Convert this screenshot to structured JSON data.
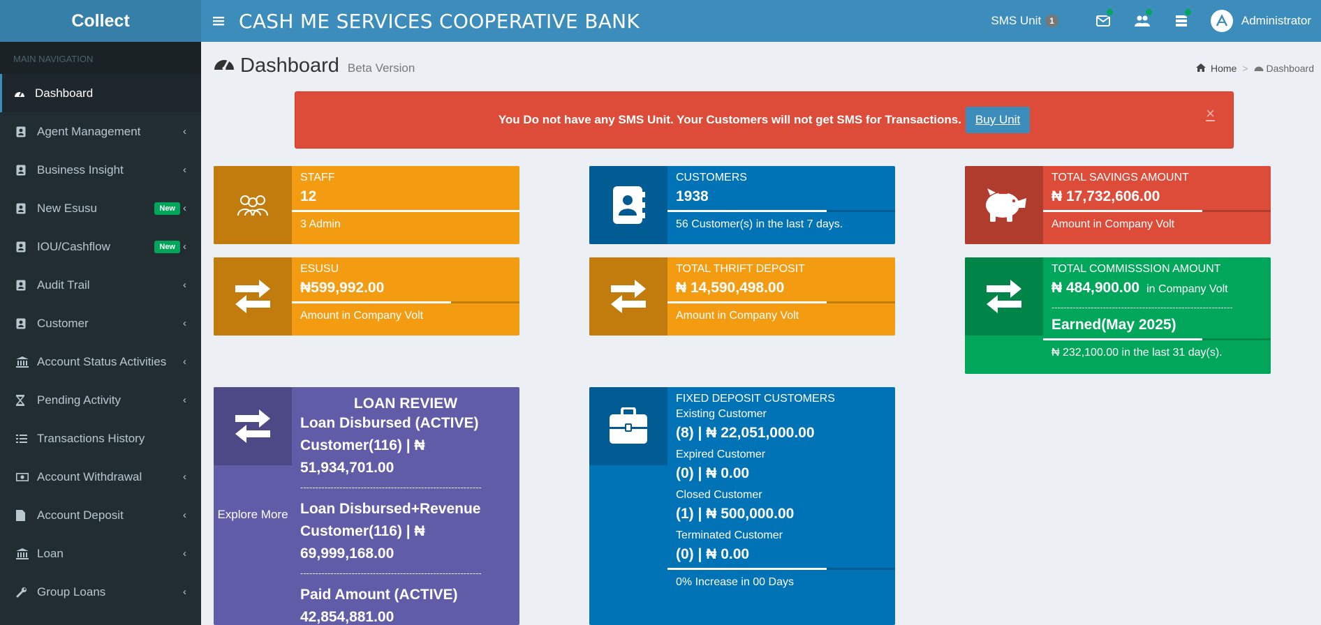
{
  "app": {
    "logo": "Collect",
    "bank_name": "CASH ME SERVICES COOPERATIVE BANK"
  },
  "topbar": {
    "sms_label": "SMS Unit",
    "sms_count": "1",
    "user_name": "Administrator",
    "icons": [
      "envelope-icon",
      "users-icon",
      "server-icon"
    ]
  },
  "sidebar": {
    "header": "MAIN NAVIGATION",
    "items": [
      {
        "label": "Dashboard",
        "icon": "dashboard-icon"
      },
      {
        "label": "Agent Management",
        "icon": "contact-icon"
      },
      {
        "label": "Business Insight",
        "icon": "contact-icon"
      },
      {
        "label": "New Esusu",
        "icon": "contact-icon",
        "badge": "New"
      },
      {
        "label": "IOU/Cashflow",
        "icon": "contact-icon",
        "badge": "New"
      },
      {
        "label": "Audit Trail",
        "icon": "contact-icon"
      },
      {
        "label": "Customer",
        "icon": "contact-icon"
      },
      {
        "label": "Account Status Activities",
        "icon": "bank-icon"
      },
      {
        "label": "Pending Activity",
        "icon": "hourglass-icon"
      },
      {
        "label": "Transactions History",
        "icon": "list-icon"
      },
      {
        "label": "Account Withdrawal",
        "icon": "money-icon"
      },
      {
        "label": "Account Deposit",
        "icon": "file-icon"
      },
      {
        "label": "Loan",
        "icon": "bank-icon"
      },
      {
        "label": "Group Loans",
        "icon": "wrench-icon"
      }
    ]
  },
  "page": {
    "title": "Dashboard",
    "subtitle": "Beta Version",
    "breadcrumb": {
      "home": "Home",
      "current": "Dashboard"
    }
  },
  "alert": {
    "text": "You Do not have any SMS Unit. Your Customers will not get SMS for Transactions.",
    "button": "Buy Unit",
    "close": "×"
  },
  "boxes": {
    "staff": {
      "label": "STAFF",
      "value": "12",
      "desc": "3 Admin",
      "progress": 1.0
    },
    "customers": {
      "label": "CUSTOMERS",
      "value": "1938",
      "desc": "56 Customer(s) in the last 7 days.",
      "progress": 0.7
    },
    "savings": {
      "label": "TOTAL SAVINGS AMOUNT",
      "value": "₦ 17,732,606.00",
      "desc": "Amount in Company Volt",
      "progress": 0.7
    },
    "esusu": {
      "label": "ESUSU",
      "value": "₦599,992.00",
      "desc": "Amount in Company Volt",
      "progress": 0.7
    },
    "thrift": {
      "label": "TOTAL THRIFT DEPOSIT",
      "value": "₦ 14,590,498.00",
      "desc": "Amount in Company Volt",
      "progress": 0.7
    },
    "commission": {
      "label": "TOTAL COMMISSSION AMOUNT",
      "value": "₦ 484,900.00",
      "value_suffix": "in Company Volt",
      "dashes": "------------------------------------------------------------",
      "earned": "Earned(May 2025)",
      "desc": "₦ 232,100.00 in the last 31 day(s).",
      "progress": 0.7
    },
    "loan": {
      "title": "LOAN REVIEW",
      "explore": "Explore More",
      "line1": "Loan Disbursed (ACTIVE) Customer(116) | ₦ 51,934,701.00",
      "line2": "Loan Disbursed+Revenue Customer(116) | ₦ 69,999,168.00",
      "line3": "Paid Amount (ACTIVE) 42,854,881.00",
      "dashes": "------------------------------------------------------------"
    },
    "fixed": {
      "label": "FIXED DEPOSIT CUSTOMERS",
      "existing_label": "Existing Customer",
      "existing_value": "(8) | ₦ 22,051,000.00",
      "expired_label": "Expired Customer",
      "expired_value": "(0) | ₦ 0.00",
      "closed_label": "Closed Customer",
      "closed_value": "(1) | ₦ 500,000.00",
      "terminated_label": "Terminated Customer",
      "terminated_value": "(0) | ₦ 0.00",
      "desc": "0% Increase in 00 Days",
      "progress": 0.7
    }
  },
  "colors": {
    "yellow": "#f39c12",
    "blue": "#0073b7",
    "red": "#dd4b39",
    "green": "#00a65a",
    "purple": "#605ca8",
    "header": "#3c8dbc",
    "sidebar": "#222d32"
  }
}
